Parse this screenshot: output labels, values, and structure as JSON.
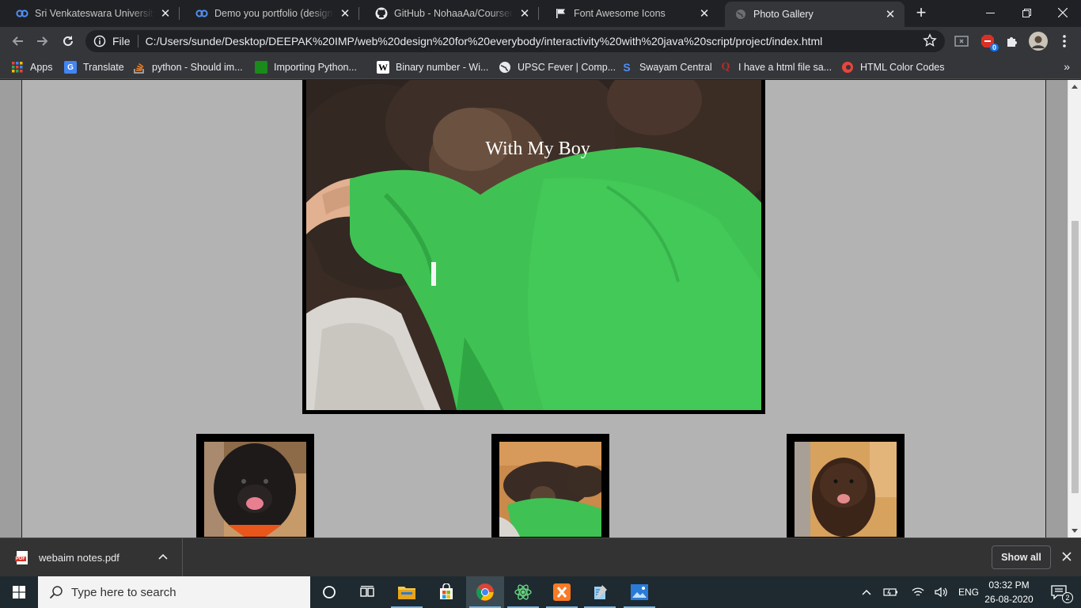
{
  "browser": {
    "tabs": [
      {
        "title": "Sri Venkateswara University on",
        "favicon": "coursera-icon"
      },
      {
        "title": "Demo you portfolio (designed",
        "favicon": "coursera-icon"
      },
      {
        "title": "GitHub - NohaaAa/Coursera-W",
        "favicon": "github-icon"
      },
      {
        "title": "Font Awesome Icons",
        "favicon": "flag-icon"
      },
      {
        "title": "Photo Gallery",
        "favicon": "globe-icon",
        "active": true
      }
    ],
    "new_tab": "+",
    "address": {
      "scheme": "File",
      "url": "C:/Users/sunde/Desktop/DEEPAK%20IMP/web%20design%20for%20everybody/interactivity%20with%20java%20script/project/index.html"
    },
    "extension_badge": "0",
    "bookmarks": [
      {
        "label": "Apps",
        "icon": "apps-grid-icon"
      },
      {
        "label": "Translate",
        "icon": "google-translate-icon"
      },
      {
        "label": "python - Should im...",
        "icon": "stackoverflow-icon"
      },
      {
        "label": "Importing Python...",
        "icon": "green-square-icon"
      },
      {
        "label": "Binary number - Wi...",
        "icon": "wikipedia-icon"
      },
      {
        "label": "UPSC Fever | Comp...",
        "icon": "globe-icon"
      },
      {
        "label": "Swayam Central",
        "icon": "swayam-icon"
      },
      {
        "label": "I have a html file sa...",
        "icon": "quora-icon"
      },
      {
        "label": "HTML Color Codes",
        "icon": "color-codes-icon"
      }
    ],
    "bookmarks_more": "»"
  },
  "page": {
    "main_caption": "With My Boy"
  },
  "downloads": {
    "file_name": "webaim notes.pdf",
    "file_type": "PDF",
    "show_all": "Show all"
  },
  "taskbar": {
    "search_placeholder": "Type here to search",
    "language": "ENG",
    "time": "03:32 PM",
    "date": "26-08-2020",
    "notification_count": "2"
  },
  "colors": {
    "page_background": "#b3b3b3",
    "image_border": "#000000",
    "shirt_green": "#3fc253"
  }
}
